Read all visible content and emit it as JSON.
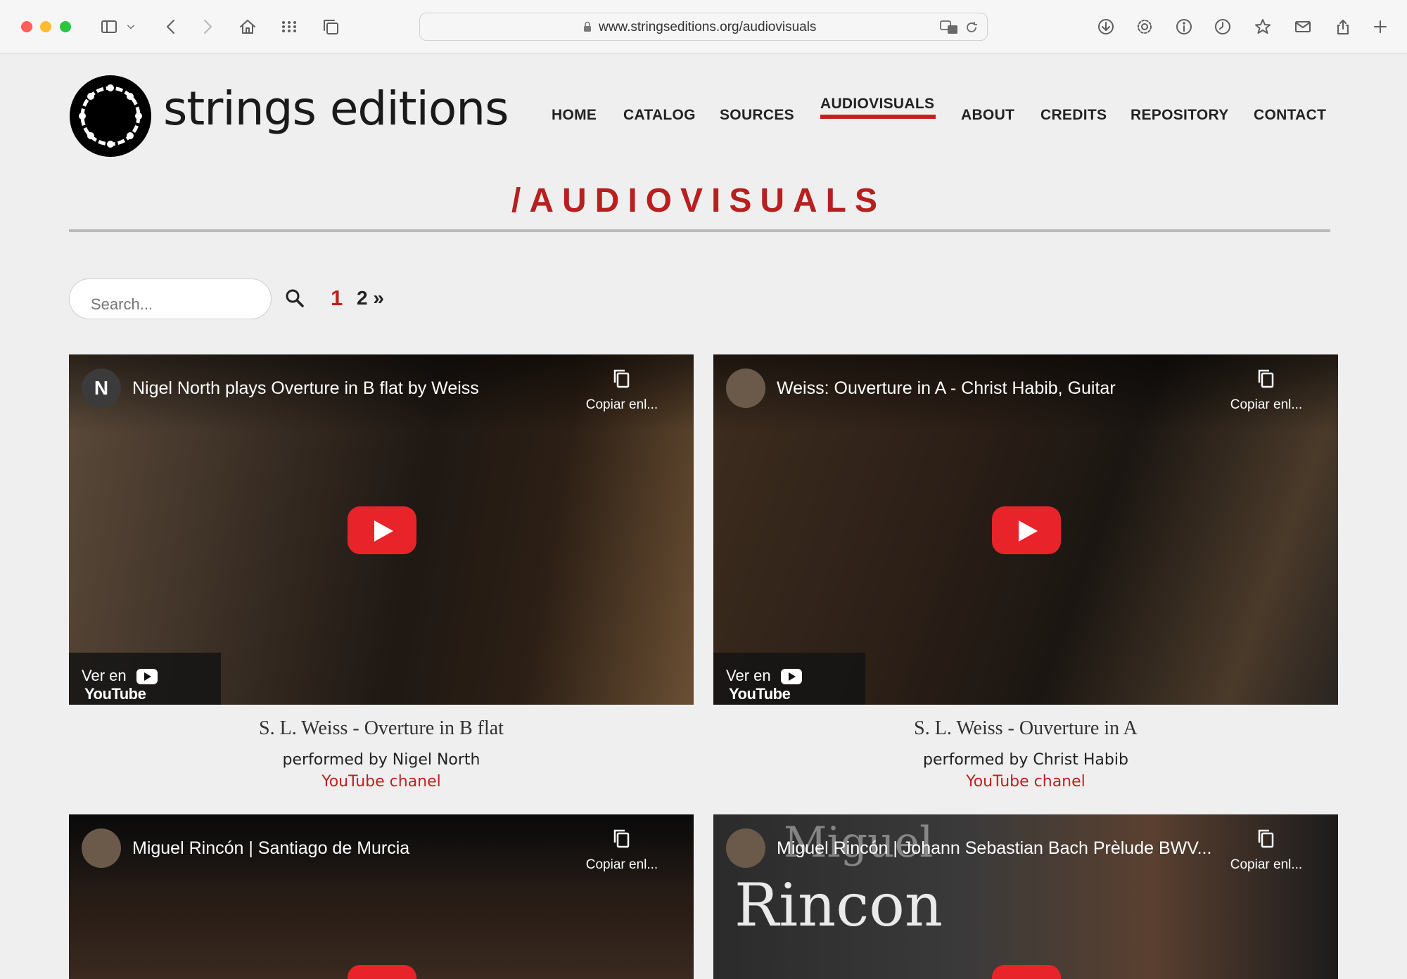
{
  "browser": {
    "url": "www.stringseditions.org/audiovisuals"
  },
  "site": {
    "name": "strings editions",
    "nav": [
      "HOME",
      "CATALOG",
      "SOURCES",
      "AUDIOVISUALS",
      "ABOUT",
      "CREDITS",
      "REPOSITORY",
      "CONTACT"
    ],
    "active_nav": "AUDIOVISUALS"
  },
  "page": {
    "title": "/AUDIOVISUALS",
    "search_placeholder": "Search...",
    "pagination": {
      "current": "1",
      "next": "2 »"
    }
  },
  "videos": [
    {
      "avatar": "N",
      "yt_title": "Nigel North plays Overture in B flat by Weiss",
      "copy_label": "Copiar enl...",
      "watch_on": "Ver en",
      "yt_brand": "YouTube",
      "title": "S. L. Weiss - Overture in B flat",
      "performer": "performed by Nigel North",
      "link": "YouTube chanel"
    },
    {
      "avatar": "",
      "yt_title": "Weiss: Ouverture in A - Christ Habib, Guitar",
      "copy_label": "Copiar enl...",
      "watch_on": "Ver en",
      "yt_brand": "YouTube",
      "title": "S. L. Weiss - Ouverture in A",
      "performer": "performed by Christ Habib",
      "link": "YouTube chanel"
    },
    {
      "avatar": "",
      "yt_title": "Miguel Rincón | Santiago de Murcia",
      "copy_label": "Copiar enl..."
    },
    {
      "avatar": "",
      "yt_title": "Miguel Rincón | Johann Sebastian Bach Prèlude BWV...",
      "copy_label": "Copiar enl...",
      "overlay_big": "Rincon",
      "overlay_ghost": "Miguel"
    }
  ],
  "colors": {
    "accent": "#c22020",
    "youtube_red": "#e8242a",
    "background": "#efefef"
  }
}
